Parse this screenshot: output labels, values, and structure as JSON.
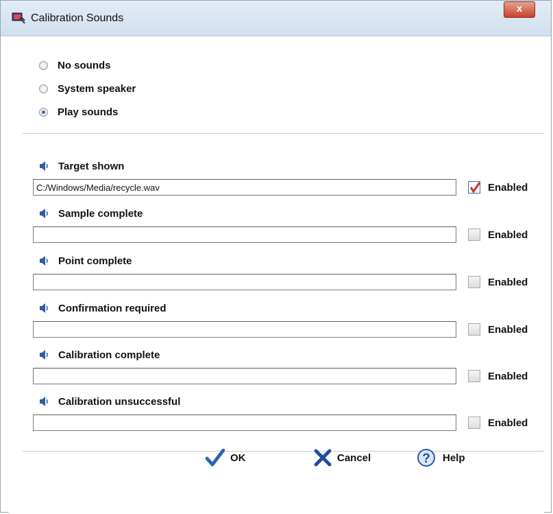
{
  "window": {
    "title": "Calibration Sounds",
    "close_label": "x"
  },
  "sound_mode": {
    "options": [
      {
        "label": "No sounds",
        "selected": false
      },
      {
        "label": "System speaker",
        "selected": false
      },
      {
        "label": "Play sounds",
        "selected": true
      }
    ]
  },
  "sounds": [
    {
      "label": "Target shown",
      "path": "C:/Windows/Media/recycle.wav",
      "enabled": true,
      "enabled_label": "Enabled"
    },
    {
      "label": "Sample complete",
      "path": "",
      "enabled": false,
      "enabled_label": "Enabled"
    },
    {
      "label": "Point complete",
      "path": "",
      "enabled": false,
      "enabled_label": "Enabled"
    },
    {
      "label": "Confirmation required",
      "path": "",
      "enabled": false,
      "enabled_label": "Enabled"
    },
    {
      "label": "Calibration complete",
      "path": "",
      "enabled": false,
      "enabled_label": "Enabled"
    },
    {
      "label": "Calibration unsuccessful",
      "path": "",
      "enabled": false,
      "enabled_label": "Enabled"
    }
  ],
  "buttons": {
    "ok": "OK",
    "cancel": "Cancel",
    "help": "Help"
  },
  "colors": {
    "check_mark": "#c0392b",
    "radio_dot": "#2f6db5",
    "ok_icon": "#2a64b8",
    "cancel_icon": "#1e4f9e"
  },
  "icons": {
    "sound": "speaker-icon",
    "app": "calibration-app-icon"
  }
}
